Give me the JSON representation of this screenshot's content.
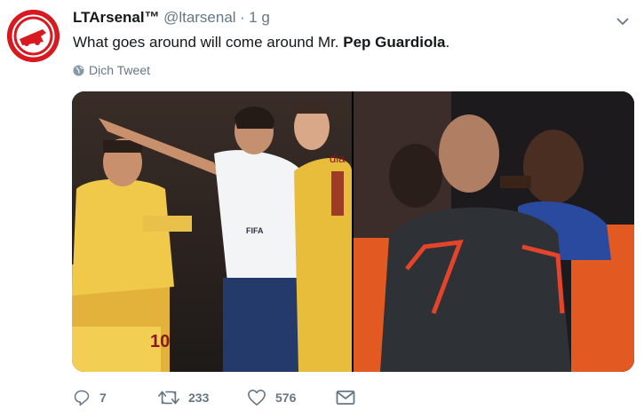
{
  "tweet": {
    "author_name": "LTArsenal™",
    "handle": "@ltarsenal",
    "separator": "·",
    "time": "1 g",
    "text_prefix": "What goes around will come around Mr. ",
    "text_bold": "Pep Guardiola",
    "text_suffix": ".",
    "translate_label": "Dịch Tweet"
  },
  "media": {
    "left_shirt_number": "10",
    "left_jersey_text": "dia",
    "referee_badge": "FIFA"
  },
  "actions": {
    "reply_count": "7",
    "retweet_count": "233",
    "like_count": "576"
  },
  "icons": {
    "reply": "reply-icon",
    "retweet": "retweet-icon",
    "like": "heart-icon",
    "message": "envelope-icon",
    "caret": "chevron-down-icon",
    "globe": "globe-icon"
  },
  "colors": {
    "brand_red": "#d71920",
    "text_secondary": "#657786"
  }
}
